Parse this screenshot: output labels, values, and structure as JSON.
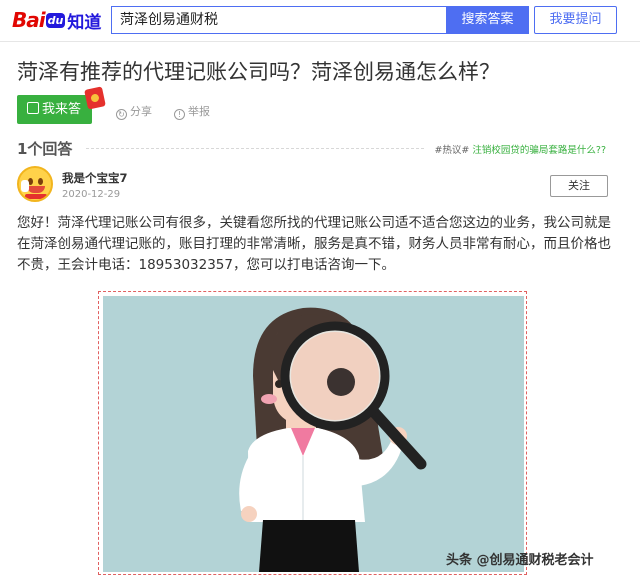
{
  "header": {
    "logo_bai": "Bai",
    "logo_du": "du",
    "logo_zhidao": "知道",
    "search_value": "菏泽创易通财税",
    "search_button": "搜索答案",
    "ask_button": "我要提问"
  },
  "question": {
    "title": "菏泽有推荐的代理记账公司吗？菏泽创易通怎么样？",
    "answer_button": "我来答",
    "share_label": "分享",
    "report_label": "举报"
  },
  "answers": {
    "count_label": "1个回答",
    "hot_tag": "#热议#",
    "hot_link": "注销校园贷的骗局套路是什么??"
  },
  "answer": {
    "user_name": "我是个宝宝7",
    "date": "2020-12-29",
    "follow_button": "关注",
    "text": "您好！菏泽代理记账公司有很多，关键看您所找的代理记账公司适不适合您这边的业务，我公司就是在菏泽创易通代理记账的，账目打理的非常清晰，服务是真不错，财务人员非常有耐心，而且价格也不贵，王会计电话：18953032357，您可以打电话咨询一下。"
  },
  "image": {
    "watermark": "头条 @创易通财税老会计",
    "bg_color": "#b3d3d6"
  },
  "colors": {
    "brand_blue": "#4e6ef2",
    "answer_green": "#38b03f"
  }
}
